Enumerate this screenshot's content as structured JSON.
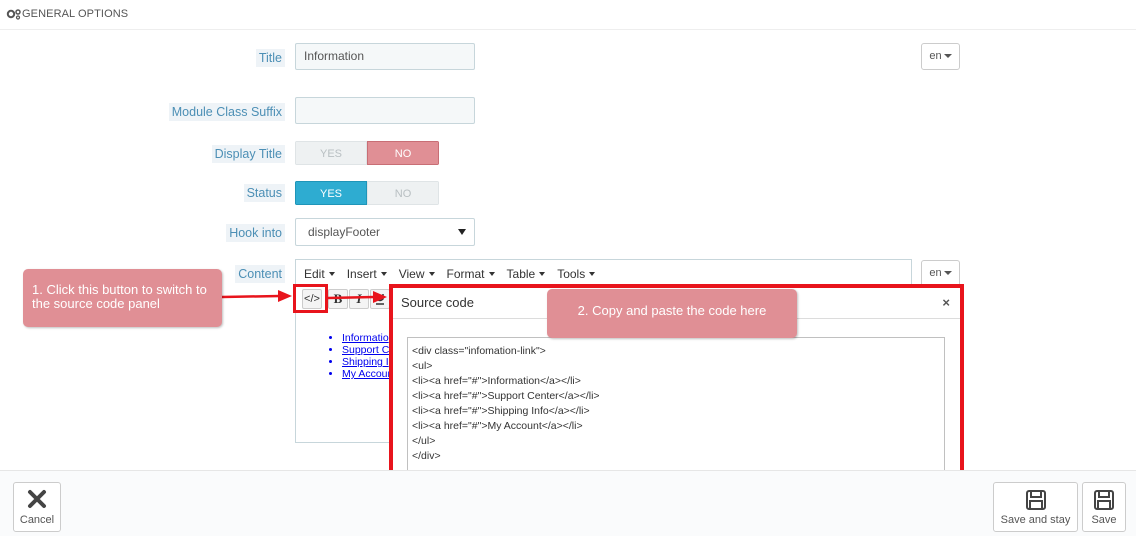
{
  "panel": {
    "title": "GENERAL OPTIONS"
  },
  "fields": {
    "title": {
      "label": "Title",
      "value": "Information"
    },
    "module_class_suffix": {
      "label": "Module Class Suffix",
      "value": ""
    },
    "display_title": {
      "label": "Display Title",
      "yes": "YES",
      "no": "NO",
      "selected": "NO"
    },
    "status": {
      "label": "Status",
      "yes": "YES",
      "no": "NO",
      "selected": "YES"
    },
    "hook_into": {
      "label": "Hook into",
      "value": "displayFooter"
    },
    "content": {
      "label": "Content"
    }
  },
  "lang": {
    "label": "en"
  },
  "editor": {
    "menu": [
      "Edit",
      "Insert",
      "View",
      "Format",
      "Table",
      "Tools"
    ],
    "toolbar": {
      "source": "</>",
      "bold": "B",
      "italic": "I"
    },
    "preview_items": [
      "Informatio",
      "Support C",
      "Shipping I",
      "My Accoun"
    ]
  },
  "annotations": {
    "step1": "1. Click this button to switch to the source code panel",
    "step2": "2. Copy and paste the code here"
  },
  "source_dialog": {
    "title": "Source code",
    "close": "×",
    "code": "<div class=\"infomation-link\">\n<ul>\n<li><a href=\"#\">Information</a></li>\n<li><a href=\"#\">Support Center</a></li>\n<li><a href=\"#\">Shipping Info</a></li>\n<li><a href=\"#\">My Account</a></li>\n</ul>\n</div>"
  },
  "footer": {
    "cancel": "Cancel",
    "save_and_stay": "Save and stay",
    "save": "Save"
  },
  "colors": {
    "label_text": "#4c8fb5",
    "switch_no_active": "#e08f95",
    "switch_yes_active": "#2eacd1",
    "highlight_red": "#e8141c",
    "note_bg": "#e08f95"
  }
}
